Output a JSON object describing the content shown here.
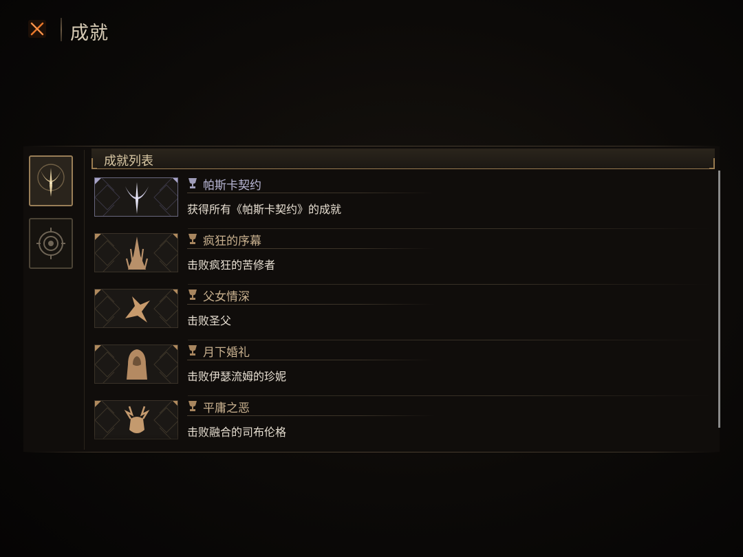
{
  "header": {
    "title": "成就",
    "close_icon": "close-x-icon"
  },
  "colors": {
    "accent_orange": "#e8772a",
    "gold_frame": "#9a7c50",
    "first_row_name": "#b9b7d6",
    "row_name": "#c9b18f",
    "desc_text": "#e7dfd2"
  },
  "sidebar": {
    "tabs": [
      {
        "icon": "crescent-blade-icon",
        "active": true
      },
      {
        "icon": "spiral-sun-icon",
        "active": false
      }
    ]
  },
  "list": {
    "title": "成就列表",
    "items": [
      {
        "name": "帕斯卡契约",
        "desc": "获得所有《帕斯卡契约》的成就",
        "icon": "crescent-blade-icon",
        "trophy_icon": "trophy-icon"
      },
      {
        "name": "疯狂的序幕",
        "desc": "击败疯狂的苦修者",
        "icon": "spire-cathedral-icon",
        "trophy_icon": "trophy-icon"
      },
      {
        "name": "父女情深",
        "desc": "击败圣父",
        "icon": "pointing-hands-icon",
        "trophy_icon": "trophy-icon"
      },
      {
        "name": "月下婚礼",
        "desc": "击败伊瑟流姆的珍妮",
        "icon": "hooded-bride-icon",
        "trophy_icon": "trophy-icon"
      },
      {
        "name": "平庸之恶",
        "desc": "击败融合的司布伦格",
        "icon": "antlered-beast-icon",
        "trophy_icon": "trophy-icon"
      }
    ]
  }
}
